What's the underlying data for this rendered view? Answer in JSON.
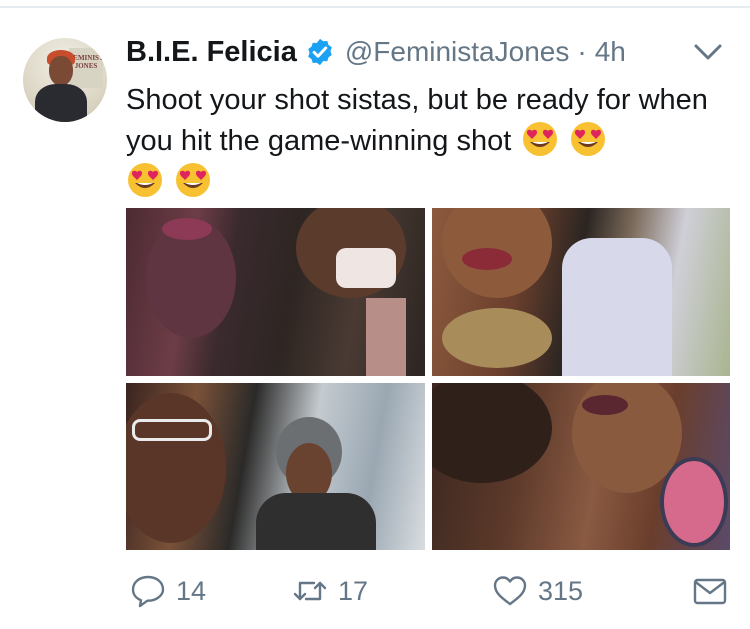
{
  "tweet": {
    "author": {
      "name": "B.I.E. Felicia",
      "handle": "@FeministaJones",
      "verified": true,
      "avatar_sign_text": "FEMINISTA JONES"
    },
    "separator": "·",
    "timestamp": "4h",
    "text": "Shoot your shot sistas, but be ready for when you hit the game-winning shot",
    "emojis": [
      "smiling-face-heart-eyes",
      "smiling-face-heart-eyes",
      "smiling-face-heart-eyes",
      "smiling-face-heart-eyes"
    ],
    "media_count": 4
  },
  "actions": {
    "reply_count": "14",
    "retweet_count": "17",
    "like_count": "315"
  },
  "colors": {
    "text": "#14171a",
    "secondary": "#657786",
    "verified_blue": "#1da1f2",
    "divider": "#e6ecf0",
    "emoji_face": "#f8c132",
    "emoji_heart": "#e0245e"
  }
}
